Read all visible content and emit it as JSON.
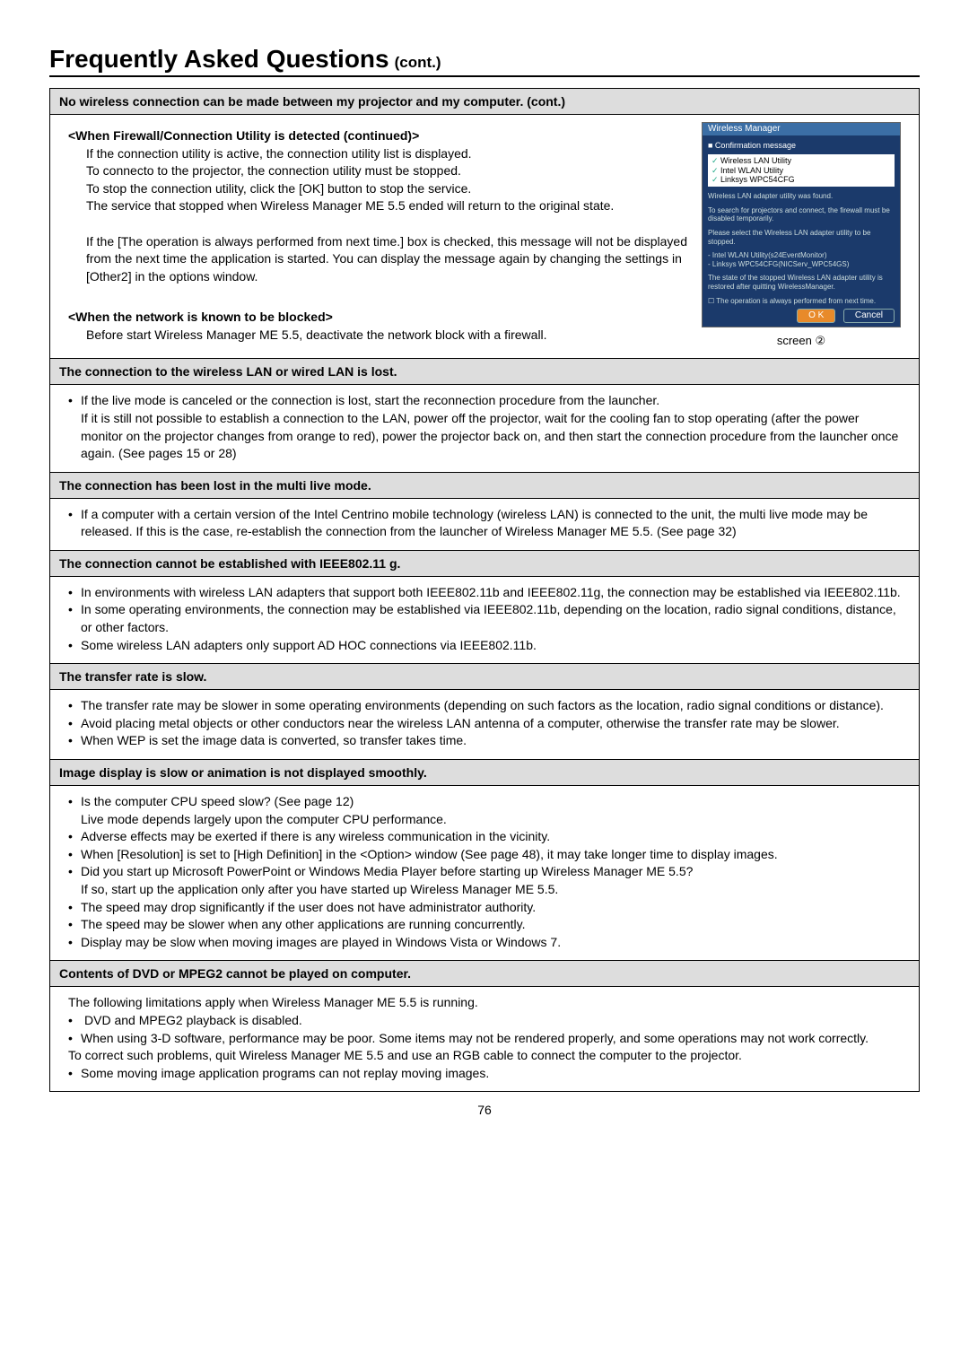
{
  "title": {
    "main": "Frequently Asked Questions",
    "cont": "(cont.)"
  },
  "s1": {
    "header": "No wireless connection can be made between my projector and my computer. (cont.)",
    "sub1": "<When Firewall/Connection Utility is detected (continued)>",
    "p1a": "If the connection utility is active, the connection utility list is displayed.",
    "p1b": "To connecto to the projector, the connection utility must be stopped.",
    "p1c": "To stop the connection utility, click the [OK] button to stop the service.",
    "p1d": "The service that stopped when Wireless Manager ME 5.5 ended will return to the original state.",
    "p2a": "If the [The operation is always performed from next time.] box is checked, this message will not be displayed from the next time the application is started. You can display the message again by changing the settings in [Other2] in the options window.",
    "sub2": "<When the network is known to be blocked>",
    "p3": "Before start Wireless Manager ME 5.5, deactivate the network block with a firewall.",
    "caption": "screen ②",
    "dialog": {
      "title": "Wireless Manager",
      "cb": "■ Confirmation message",
      "li1": "Wireless LAN Utility",
      "li2": "Intel WLAN Utility",
      "li3": "Linksys WPC54CFG",
      "n1": "Wireless LAN adapter utility was found.",
      "n2": "To search for projectors and connect, the firewall must be disabled temporarily.",
      "n3": "Please select the Wireless LAN adapter utility to be stopped.",
      "n4": "- Intel WLAN Utility(s24EventMonitor)\n- Linksys WPC54CFG(NICServ_WPC54GS)",
      "n5": "The state of the stopped Wireless LAN adapter utility is restored after quitting WirelessManager.",
      "cb2": "☐ The operation is always performed from next time.",
      "ok": "O K",
      "cancel": "Cancel"
    }
  },
  "s2": {
    "header": "The connection to the wireless LAN or wired LAN is lost.",
    "b1": "If the live mode is canceled or the connection is lost, start the reconnection procedure from the launcher.\nIf it is still not possible to establish a connection to the LAN, power off the projector, wait for the cooling fan to stop operating (after the power monitor on the projector changes from orange to red), power the projector back on, and then start the connection procedure from the launcher once again. (See pages 15 or 28)"
  },
  "s3": {
    "header": "The connection has been lost in the multi live mode.",
    "b1": "If a computer with a certain version of the Intel Centrino mobile technology (wireless LAN) is connected to the unit, the multi live mode may be released. If this is the case, re-establish the connection from the launcher of Wireless Manager ME 5.5. (See page 32)"
  },
  "s4": {
    "header": "The connection cannot be established with IEEE802.11 g.",
    "b1": "In environments with wireless LAN adapters that support both IEEE802.11b and IEEE802.11g, the connection may be established via IEEE802.11b.",
    "b2": "In some operating environments, the connection may be established via IEEE802.11b, depending on the location, radio signal conditions, distance, or other factors.",
    "b3": "Some wireless LAN adapters only support AD HOC connections via IEEE802.11b."
  },
  "s5": {
    "header": "The transfer rate is slow.",
    "b1": "The transfer rate may be slower in some operating environments (depending on such factors as the location, radio signal conditions or distance).",
    "b2": "Avoid placing metal objects or other conductors near the wireless LAN antenna of a computer, otherwise the transfer rate may be slower.",
    "b3": "When WEP is set the image data is converted, so transfer takes time."
  },
  "s6": {
    "header": "Image display is slow or animation is not displayed smoothly.",
    "b1": "Is the computer CPU speed slow? (See page 12)",
    "b1a": "Live mode depends largely upon the computer CPU performance.",
    "b2": "Adverse effects may be exerted if there is any wireless communication in the vicinity.",
    "b3": "When [Resolution] is set to [High Definition] in the <Option> window (See page 48), it may take longer time to display images.",
    "b4": "Did you start up Microsoft PowerPoint or Windows Media Player before starting up Wireless Manager ME 5.5?",
    "b4a": "If so, start up the application only after you have started up Wireless Manager ME 5.5.",
    "b5": "The speed may drop significantly if the user does not have administrator authority.",
    "b6": "The speed may be slower when any other applications are running concurrently.",
    "b7": "Display may be slow when moving images are played in Windows Vista or Windows 7."
  },
  "s7": {
    "header": "Contents of DVD or MPEG2 cannot be played on computer.",
    "p1": "The following limitations apply when Wireless Manager ME 5.5 is running.",
    "b1": "DVD and MPEG2 playback is disabled.",
    "b2": "When using 3-D software, performance may be poor. Some items may not be rendered properly, and some operations may not work correctly.",
    "p2": "To correct such problems, quit Wireless Manager ME 5.5 and use an RGB cable to connect the computer to the projector.",
    "b3": "Some moving image application programs can not replay moving images."
  },
  "pageno": "76"
}
